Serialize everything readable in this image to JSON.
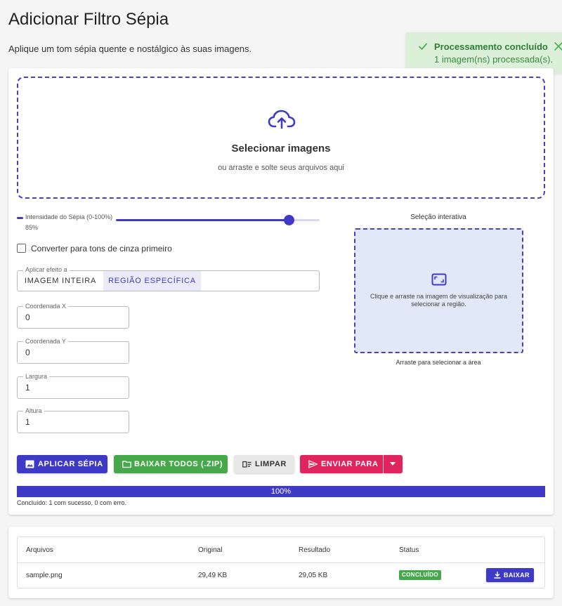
{
  "header": {
    "title": "Adicionar Filtro Sépia",
    "subtitle": "Aplique um tom sépia quente e nostálgico às suas imagens."
  },
  "toast": {
    "title": "Processamento concluído",
    "message": "1 imagem(ns) processada(s).",
    "icon": "check-icon",
    "close_icon": "close-icon"
  },
  "dropzone": {
    "icon": "cloud-upload-icon",
    "title": "Selecionar imagens",
    "subtitle": "ou arraste e solte seus arquivos aqui"
  },
  "slider": {
    "label": "Intensidade do Sépia (0-100%)",
    "value_text": "85%",
    "value": 85,
    "min": 0,
    "max": 100
  },
  "grayscale": {
    "label": "Converter para tons de cinza primeiro",
    "checked": false
  },
  "apply_mode": {
    "legend": "Aplicar efeito a",
    "options": [
      "IMAGEM INTEIRA",
      "REGIÃO ESPECÍFICA"
    ],
    "selected": "REGIÃO ESPECÍFICA"
  },
  "fields": {
    "x": {
      "label": "Coordenada X",
      "value": "0"
    },
    "y": {
      "label": "Coordenada Y",
      "value": "0"
    },
    "width": {
      "label": "Largura",
      "value": "1"
    },
    "height": {
      "label": "Altura",
      "value": "1"
    }
  },
  "selection": {
    "title": "Seleção interativa",
    "icon": "crop-frame-icon",
    "hint": "Clique e arraste na imagem de visualização para selecionar a região.",
    "caption": "Arraste para selecionar a área"
  },
  "actions": {
    "apply": "APLICAR SÉPIA",
    "zip": "BAIXAR TODOS (.ZIP)",
    "clear": "LIMPAR",
    "send": "ENVIAR PARA"
  },
  "progress": {
    "percent": 100,
    "text": "100%",
    "status": "Concluído: 1 com sucesso, 0 com erro."
  },
  "table": {
    "headers": [
      "Arquivos",
      "Original",
      "Resultado",
      "Status"
    ],
    "rows": [
      {
        "file": "sample.png",
        "original": "29,49 KB",
        "result": "29,05 KB",
        "status": "CONCLUÍDO",
        "action": "BAIXAR"
      }
    ]
  },
  "colors": {
    "primary": "#3f3ac6",
    "success": "#46a84a",
    "accent": "#e0245e",
    "toast_bg": "#dcefd9"
  }
}
